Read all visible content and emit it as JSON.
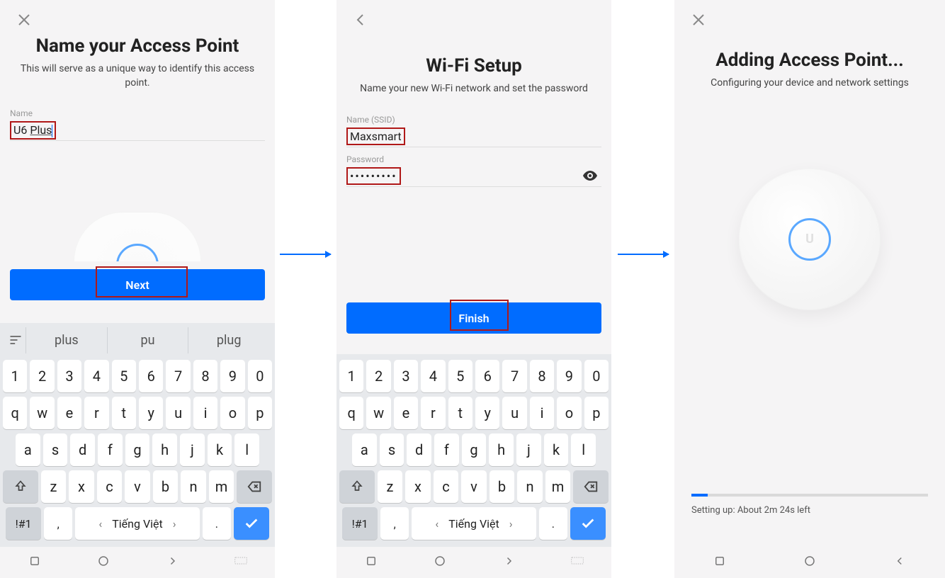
{
  "screen1": {
    "title": "Name your Access Point",
    "subtitle": "This will serve as a unique way to identify this access point.",
    "name_label": "Name",
    "name_value": "U6 Plus",
    "name_value_prefix": "U6 ",
    "name_value_underlined": "Plus",
    "button": "Next",
    "suggestions": [
      "plus",
      "pu",
      "plug"
    ]
  },
  "screen2": {
    "title": "Wi-Fi Setup",
    "subtitle": "Name your new Wi-Fi network and set the password",
    "ssid_label": "Name (SSID)",
    "ssid_value": "Maxsmart",
    "password_label": "Password",
    "password_masked": "•••••••••",
    "button": "Finish"
  },
  "screen3": {
    "title": "Adding Access Point...",
    "subtitle": "Configuring your device and network settings",
    "progress_percent": 7,
    "progress_label": "Setting up: About 2m 24s left"
  },
  "keyboard": {
    "row_num": [
      "1",
      "2",
      "3",
      "4",
      "5",
      "6",
      "7",
      "8",
      "9",
      "0"
    ],
    "row_q": [
      "q",
      "w",
      "e",
      "r",
      "t",
      "y",
      "u",
      "i",
      "o",
      "p"
    ],
    "row_a": [
      "a",
      "s",
      "d",
      "f",
      "g",
      "h",
      "j",
      "k",
      "l"
    ],
    "row_z": [
      "z",
      "x",
      "c",
      "v",
      "b",
      "n",
      "m"
    ],
    "symbol_key": "!#1",
    "comma_key": ",",
    "period_key": ".",
    "space_label": "Tiếng Việt"
  }
}
